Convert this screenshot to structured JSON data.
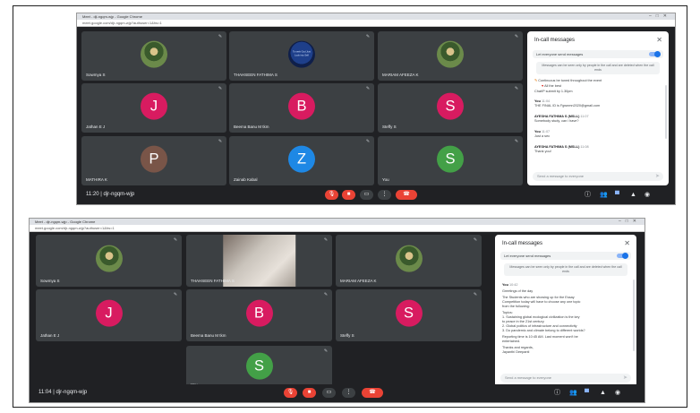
{
  "shot1": {
    "chrome_title": "Meet - dji-ngqm-wjp - Google Chrome",
    "url": "meet.google.com/djr-ngqm-wjp?authuser=1&hs=1",
    "tiles": [
      {
        "name": "Sowmya S",
        "kind": "photo"
      },
      {
        "name": "THAHSEEN FATHIMA S",
        "kind": "logo",
        "logo_text": "To seek God Just Look into Self"
      },
      {
        "name": "MARIAM AFEEZA K",
        "kind": "photo"
      },
      {
        "name": "Jathan E J",
        "kind": "avatar",
        "letter": "J",
        "color": "#d81b60"
      },
      {
        "name": "Beema Banu M tkm",
        "kind": "avatar",
        "letter": "B",
        "color": "#d81b60"
      },
      {
        "name": "Steffy S",
        "kind": "avatar",
        "letter": "S",
        "color": "#d81b60"
      },
      {
        "name": "MATHIRA K",
        "kind": "avatar",
        "letter": "P",
        "color": "#795548"
      },
      {
        "name": "Zainab Kabal",
        "kind": "avatar",
        "letter": "Z",
        "color": "#1e88e5"
      },
      {
        "name": "You",
        "kind": "avatar",
        "letter": "S",
        "color": "#43a047"
      }
    ],
    "time": "11:20",
    "meeting_code": "djr-ngqm-wjp",
    "chat": {
      "title": "In-call messages",
      "toggle_label": "Let everyone send messages",
      "info": "Messages can be seen only by people in the call and are deleted when the call ends",
      "pinned": "Continuous be tuned throughout the event",
      "pinned2": "All the best",
      "pinned3": "Chat/P submit by 1.30pm",
      "messages": [
        {
          "sender": "You",
          "time": "11:04",
          "text": "THE FINAL ID is Fgwnmn2020@gmail.com"
        },
        {
          "sender": "AYESHA FATHIMA S (MSLL)",
          "time": "11:07",
          "text": "Somebody study, can i have?"
        },
        {
          "sender": "You",
          "time": "11:07",
          "text": "Just a sec"
        },
        {
          "sender": "AYESHA FATHIMA S (MSLL)",
          "time": "11:08",
          "text": "Thank you!"
        }
      ],
      "compose_placeholder": "Send a message to everyone"
    }
  },
  "shot2": {
    "chrome_title": "Meet - djr-ngqm-wjp - Google Chrome",
    "url": "meet.google.com/djr-ngqm-wjp?authuser=1&hs=1",
    "tiles": [
      {
        "name": "Sowmya S",
        "kind": "photo"
      },
      {
        "name": "THAHSEEN FATHIMA S",
        "kind": "video"
      },
      {
        "name": "MARIAM AFEEZA K",
        "kind": "photo"
      },
      {
        "name": "Jathan E J",
        "kind": "avatar",
        "letter": "J",
        "color": "#d81b60"
      },
      {
        "name": "Beema Banu M tkm",
        "kind": "avatar",
        "letter": "B",
        "color": "#d81b60"
      },
      {
        "name": "Steffy S",
        "kind": "avatar",
        "letter": "S",
        "color": "#d81b60"
      },
      {
        "name": "You",
        "kind": "avatar",
        "letter": "S",
        "color": "#43a047"
      }
    ],
    "time": "11:04",
    "meeting_code": "djr-ngqm-wjp",
    "chat": {
      "title": "In-call messages",
      "toggle_label": "Let everyone send messages",
      "info": "Messages can be seen only by people in the call and are deleted when the call ends",
      "sender": "You",
      "time": "10:42",
      "lines": [
        "Greetings of the day",
        "The Students who are showing up for the Essay",
        "Competition today will have to choose any one topic",
        "from the following:",
        "Topics:",
        "1. Sustaining global ecological civilization is the key",
        "to peace in the 21st century.",
        "2. Global politics of infrastructure and connectivity",
        "3. Do pandemic and climate belong to different worlds?",
        "Reporting time is 10:45 AM. Last moment won't be",
        "entertained.",
        "Thanks and regards,",
        "Jayanthi Deepanti"
      ],
      "compose_placeholder": "Send a message to everyone"
    }
  }
}
